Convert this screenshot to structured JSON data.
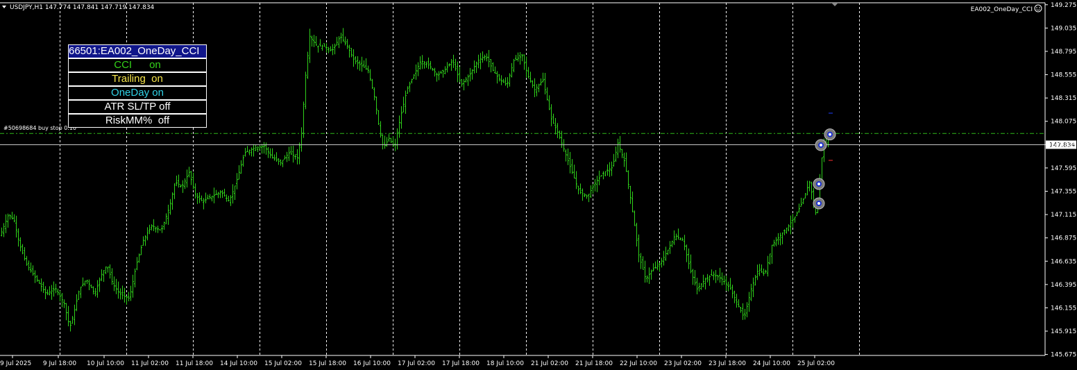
{
  "header": {
    "symbol_line": "USDJPY,H1  147.774 147.841 147.719 147.834",
    "ea_name": "EA002_OneDay_CCI",
    "collapse_icon": "triangle-down-icon",
    "smile_icon": "smiley-icon"
  },
  "order_label": "#50698684 buy stop 0.10",
  "current_price": "147.834",
  "panel": {
    "title": "66501:EA002_OneDay_CCI",
    "rows": [
      {
        "label": "CCI      on",
        "color": "#34d11a"
      },
      {
        "label": "Trailing  on",
        "color": "#f7e54a"
      },
      {
        "label": "OneDay on",
        "color": "#31d3e8"
      },
      {
        "label": "ATR SL/TP off",
        "color": "#ffffff"
      },
      {
        "label": "RiskMM%  off",
        "color": "#ffffff"
      }
    ]
  },
  "colors": {
    "background": "#000000",
    "candle": "#2fd11a",
    "grid": "#ffffff",
    "order_line": "#2fb81a",
    "price_line": "#c8c8c8",
    "panel_title_bg": "#10168a"
  },
  "chart_data": {
    "type": "candlestick",
    "symbol": "USDJPY",
    "timeframe": "H1",
    "y_axis_ticks": [
      149.275,
      149.035,
      148.795,
      148.555,
      148.315,
      148.075,
      147.835,
      147.595,
      147.355,
      147.115,
      146.875,
      146.635,
      146.395,
      146.155,
      145.915,
      145.675
    ],
    "y_axis_labels": [
      "149.275",
      "149.035",
      "148.795",
      "148.555",
      "148.315",
      "148.075",
      "147.835",
      "147.595",
      "147.355",
      "147.115",
      "146.875",
      "146.635",
      "146.395",
      "146.155",
      "145.915",
      "145.675"
    ],
    "ylim": [
      145.665,
      149.295
    ],
    "x_axis_labels": [
      "9 Jul 2025",
      "9 Jul 18:00",
      "10 Jul 10:00",
      "11 Jul 02:00",
      "11 Jul 18:00",
      "14 Jul 10:00",
      "15 Jul 02:00",
      "15 Jul 18:00",
      "16 Jul 10:00",
      "17 Jul 02:00",
      "17 Jul 18:00",
      "18 Jul 10:00",
      "21 Jul 02:00",
      "21 Jul 18:00",
      "22 Jul 10:00",
      "23 Jul 02:00",
      "23 Jul 18:00",
      "24 Jul 10:00",
      "25 Jul 02:00"
    ],
    "buy_stop_price": 147.95,
    "current_price": 147.834,
    "close_path": [
      [
        0,
        146.9
      ],
      [
        12,
        147.12
      ],
      [
        20,
        147.05
      ],
      [
        28,
        146.8
      ],
      [
        38,
        146.6
      ],
      [
        52,
        146.45
      ],
      [
        66,
        146.3
      ],
      [
        80,
        146.35
      ],
      [
        92,
        146.2
      ],
      [
        100,
        145.95
      ],
      [
        106,
        146.1
      ],
      [
        114,
        146.35
      ],
      [
        124,
        146.45
      ],
      [
        136,
        146.3
      ],
      [
        146,
        146.5
      ],
      [
        154,
        146.6
      ],
      [
        162,
        146.4
      ],
      [
        172,
        146.3
      ],
      [
        186,
        146.25
      ],
      [
        196,
        146.6
      ],
      [
        206,
        146.85
      ],
      [
        218,
        147.0
      ],
      [
        232,
        146.95
      ],
      [
        244,
        147.2
      ],
      [
        252,
        147.45
      ],
      [
        262,
        147.4
      ],
      [
        272,
        147.55
      ],
      [
        282,
        147.3
      ],
      [
        292,
        147.25
      ],
      [
        304,
        147.3
      ],
      [
        318,
        147.35
      ],
      [
        330,
        147.25
      ],
      [
        340,
        147.45
      ],
      [
        352,
        147.75
      ],
      [
        366,
        147.8
      ],
      [
        380,
        147.82
      ],
      [
        392,
        147.7
      ],
      [
        404,
        147.65
      ],
      [
        416,
        147.75
      ],
      [
        428,
        147.7
      ],
      [
        434,
        147.95
      ],
      [
        440,
        148.55
      ],
      [
        446,
        148.95
      ],
      [
        456,
        148.85
      ],
      [
        466,
        148.85
      ],
      [
        478,
        148.8
      ],
      [
        490,
        148.95
      ],
      [
        500,
        148.85
      ],
      [
        510,
        148.7
      ],
      [
        520,
        148.65
      ],
      [
        530,
        148.6
      ],
      [
        540,
        148.3
      ],
      [
        546,
        148.0
      ],
      [
        552,
        147.8
      ],
      [
        560,
        147.9
      ],
      [
        568,
        147.8
      ],
      [
        576,
        148.1
      ],
      [
        586,
        148.4
      ],
      [
        596,
        148.55
      ],
      [
        606,
        148.7
      ],
      [
        618,
        148.65
      ],
      [
        630,
        148.55
      ],
      [
        640,
        148.6
      ],
      [
        652,
        148.7
      ],
      [
        664,
        148.45
      ],
      [
        676,
        148.55
      ],
      [
        688,
        148.7
      ],
      [
        700,
        148.75
      ],
      [
        710,
        148.6
      ],
      [
        720,
        148.5
      ],
      [
        730,
        148.45
      ],
      [
        740,
        148.7
      ],
      [
        752,
        148.75
      ],
      [
        760,
        148.55
      ],
      [
        770,
        148.4
      ],
      [
        782,
        148.5
      ],
      [
        794,
        148.1
      ],
      [
        804,
        147.95
      ],
      [
        814,
        147.75
      ],
      [
        824,
        147.55
      ],
      [
        834,
        147.35
      ],
      [
        846,
        147.3
      ],
      [
        858,
        147.45
      ],
      [
        870,
        147.55
      ],
      [
        882,
        147.6
      ],
      [
        890,
        147.85
      ],
      [
        900,
        147.65
      ],
      [
        910,
        147.2
      ],
      [
        920,
        146.7
      ],
      [
        930,
        146.45
      ],
      [
        940,
        146.55
      ],
      [
        950,
        146.6
      ],
      [
        962,
        146.75
      ],
      [
        972,
        146.9
      ],
      [
        984,
        146.85
      ],
      [
        994,
        146.55
      ],
      [
        1004,
        146.35
      ],
      [
        1016,
        146.45
      ],
      [
        1028,
        146.5
      ],
      [
        1040,
        146.45
      ],
      [
        1052,
        146.35
      ],
      [
        1062,
        146.2
      ],
      [
        1072,
        146.05
      ],
      [
        1082,
        146.35
      ],
      [
        1092,
        146.55
      ],
      [
        1102,
        146.5
      ],
      [
        1112,
        146.8
      ],
      [
        1124,
        146.9
      ],
      [
        1136,
        147.0
      ],
      [
        1146,
        147.1
      ],
      [
        1156,
        147.25
      ],
      [
        1166,
        147.45
      ],
      [
        1176,
        147.1
      ],
      [
        1186,
        147.85
      ],
      [
        1194,
        147.834
      ]
    ],
    "trade_markers": [
      {
        "x_index": 1180,
        "price": 147.23
      },
      {
        "x_index": 1180,
        "price": 147.43
      },
      {
        "x_index": 1183,
        "price": 147.83
      },
      {
        "x_index": 1196,
        "price": 147.94
      }
    ]
  }
}
